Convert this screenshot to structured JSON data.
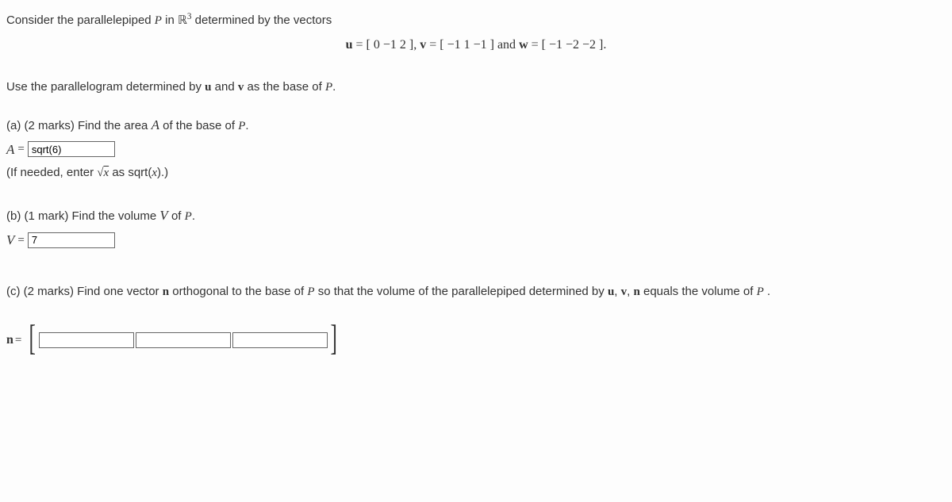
{
  "intro_prefix": "Consider the parallelepiped ",
  "intro_p": "P",
  "intro_mid": " in ",
  "intro_r3": "ℝ",
  "intro_sup": "3",
  "intro_suffix": " determined  by the vectors",
  "equation": "u = [ 0   −1   2 ],   v = [ −1   1   −1 ]  and  w = [ −1   −2   −2 ].",
  "eq_u": "u",
  "eq_eq": " = ",
  "eq_u_vec": "[ 0   −1   2 ]",
  "eq_comma": ",  ",
  "eq_v": "v",
  "eq_v_vec": "[ −1   1   −1 ]",
  "eq_and": " and ",
  "eq_w": "w",
  "eq_w_vec": "[ −1   −2   −2 ].",
  "base_sentence_1": "Use the parallelogram determined by ",
  "base_u": "u",
  "base_mid": " and ",
  "base_v": "v",
  "base_end": " as the base of ",
  "base_P": "P",
  "base_period": ".",
  "a_label": "(a) (2 marks)   Find the area ",
  "a_A": "A",
  "a_mid": " of the base of ",
  "a_P": "P",
  "a_period": ".",
  "a_eq_A": "A",
  "a_eq_sign": " =",
  "a_value": "sqrt(6)",
  "hint_prefix": "(If needed, enter ",
  "hint_sqrt": "√",
  "hint_x": "x",
  "hint_mid": " as sqrt(",
  "hint_x2": "x",
  "hint_suffix": ").)",
  "b_label": "(b) (1 mark) Find the volume ",
  "b_V": "V",
  "b_of": " of ",
  "b_P": "P",
  "b_period": ".",
  "b_eq_V": "V",
  "b_eq_sign": " =",
  "b_value": "7",
  "c_label": "(c) (2 marks) Find one vector ",
  "c_n": "n",
  "c_mid1": " orthogonal to the base of ",
  "c_P": "P",
  "c_mid2": " so that the volume of the parallelepiped determined by ",
  "c_u": "u",
  "c_c1": ", ",
  "c_v": "v",
  "c_c2": ", ",
  "c_n2": "n",
  "c_mid3": " equals the volume of ",
  "c_P2": "P",
  "c_end": " .",
  "n_label": "n",
  "n_eq": " =",
  "n1": "",
  "n2": "",
  "n3": ""
}
